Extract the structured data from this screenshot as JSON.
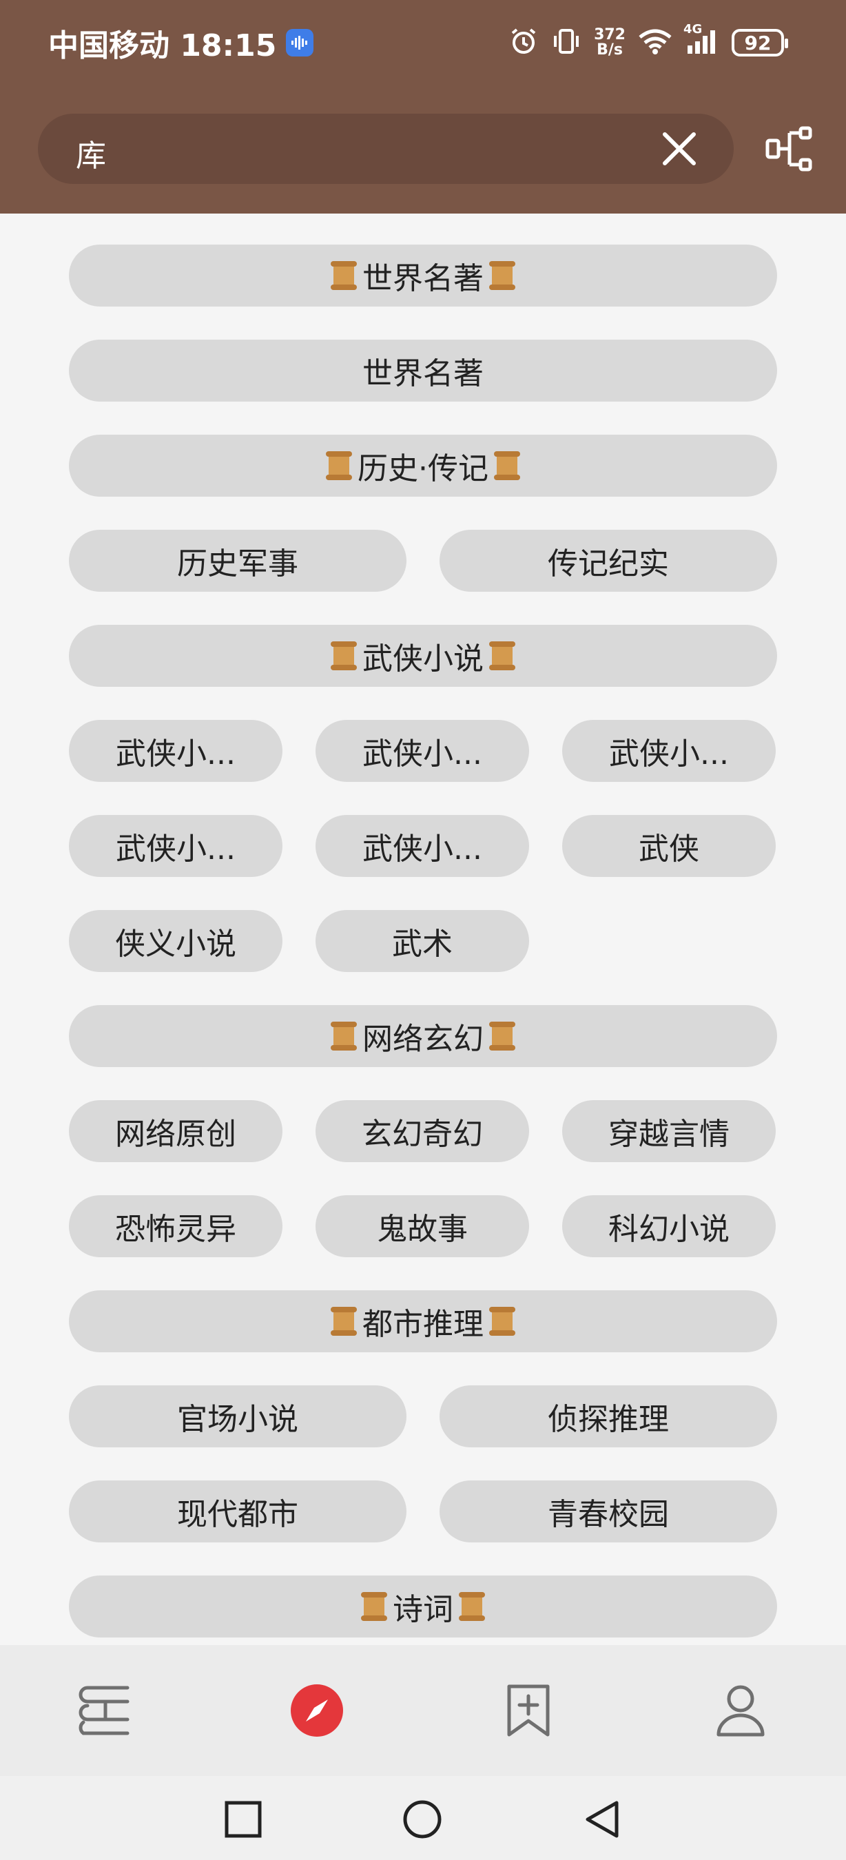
{
  "status": {
    "carrier_time": "中国移动 18:15",
    "net_speed_top": "372",
    "net_speed_bottom": "B/s",
    "network_label": "4G",
    "battery": "92"
  },
  "search": {
    "query": "库"
  },
  "colors": {
    "header": "#7a5646",
    "accent": "#e4373b"
  },
  "list": {
    "world": {
      "header": "世界名著",
      "items": [
        "世界名著"
      ]
    },
    "history": {
      "header": "历史·传记",
      "items": [
        "历史军事",
        "传记纪实"
      ]
    },
    "wuxia": {
      "header": "武侠小说",
      "items": [
        "武侠小...",
        "武侠小...",
        "武侠小...",
        "武侠小...",
        "武侠小...",
        "武侠",
        "侠义小说",
        "武术"
      ]
    },
    "xuanhuan": {
      "header": "网络玄幻",
      "items": [
        "网络原创",
        "玄幻奇幻",
        "穿越言情",
        "恐怖灵异",
        "鬼故事",
        "科幻小说"
      ]
    },
    "dushi": {
      "header": "都市推理",
      "items": [
        "官场小说",
        "侦探推理",
        "现代都市",
        "青春校园"
      ]
    },
    "poetry": {
      "header": "诗词"
    }
  },
  "nav": {
    "items": [
      "bookshelf-icon",
      "compass-icon",
      "bookmark-add-icon",
      "profile-icon"
    ],
    "active": "compass-icon"
  },
  "sysnav": [
    "recent-apps-icon",
    "home-icon",
    "back-icon"
  ]
}
